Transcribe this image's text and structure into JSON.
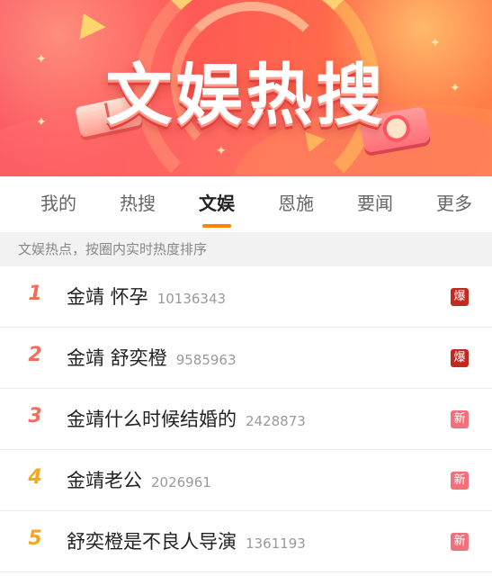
{
  "banner": {
    "title": "文娱热搜"
  },
  "tabs": [
    {
      "label": "我的"
    },
    {
      "label": "热搜"
    },
    {
      "label": "文娱"
    },
    {
      "label": "恩施"
    },
    {
      "label": "要闻"
    },
    {
      "label": "更多"
    }
  ],
  "active_tab": "文娱",
  "subtitle": "文娱热点，按圈内实时热度排序",
  "items": [
    {
      "rank": "1",
      "title": "金靖 怀孕",
      "count": "10136343",
      "badge": "爆"
    },
    {
      "rank": "2",
      "title": "金靖 舒奕橙",
      "count": "9585963",
      "badge": "爆"
    },
    {
      "rank": "3",
      "title": "金靖什么时候结婚的",
      "count": "2428873",
      "badge": "新"
    },
    {
      "rank": "4",
      "title": "金靖老公",
      "count": "2026961",
      "badge": "新"
    },
    {
      "rank": "5",
      "title": "舒奕橙是不良人导演",
      "count": "1361193",
      "badge": "新"
    }
  ],
  "colors": {
    "tab_underline": "#ff8200",
    "rank_top3": "#f26d5b",
    "rank_other": "#f5a623",
    "badge_hot": "#c4291f",
    "badge_new": "#f3707b"
  }
}
